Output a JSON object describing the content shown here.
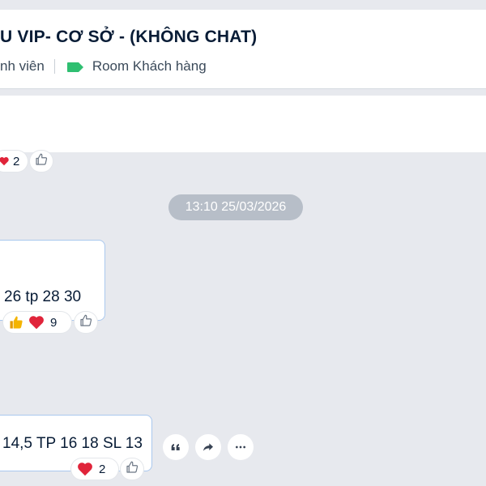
{
  "header": {
    "title": "U VIP- CƠ SỞ - (KHÔNG CHAT)",
    "members_text": "nh viên",
    "room_tag_label": "Room Khách hàng",
    "tag_color": "#2fbf71"
  },
  "date_divider": "13:10 25/03/2026",
  "messages": [
    {
      "text": "",
      "reactions": [
        {
          "icon": "heart",
          "count": "2"
        }
      ]
    },
    {
      "text": "26 tp 28 30",
      "reactions": [
        {
          "icon": "thumbs-up"
        },
        {
          "icon": "heart",
          "count": "9"
        }
      ]
    },
    {
      "text": "14,5 TP 16 18 SL 13",
      "reactions": [
        {
          "icon": "heart",
          "count": "2"
        }
      ],
      "actions": [
        "quote-icon",
        "share-icon",
        "more-icon"
      ]
    }
  ],
  "colors": {
    "heart": "#e0243a",
    "thumb": "#f4b400",
    "bubble_border": "#a9c8ee",
    "chat_bg": "#e7e9ee"
  }
}
